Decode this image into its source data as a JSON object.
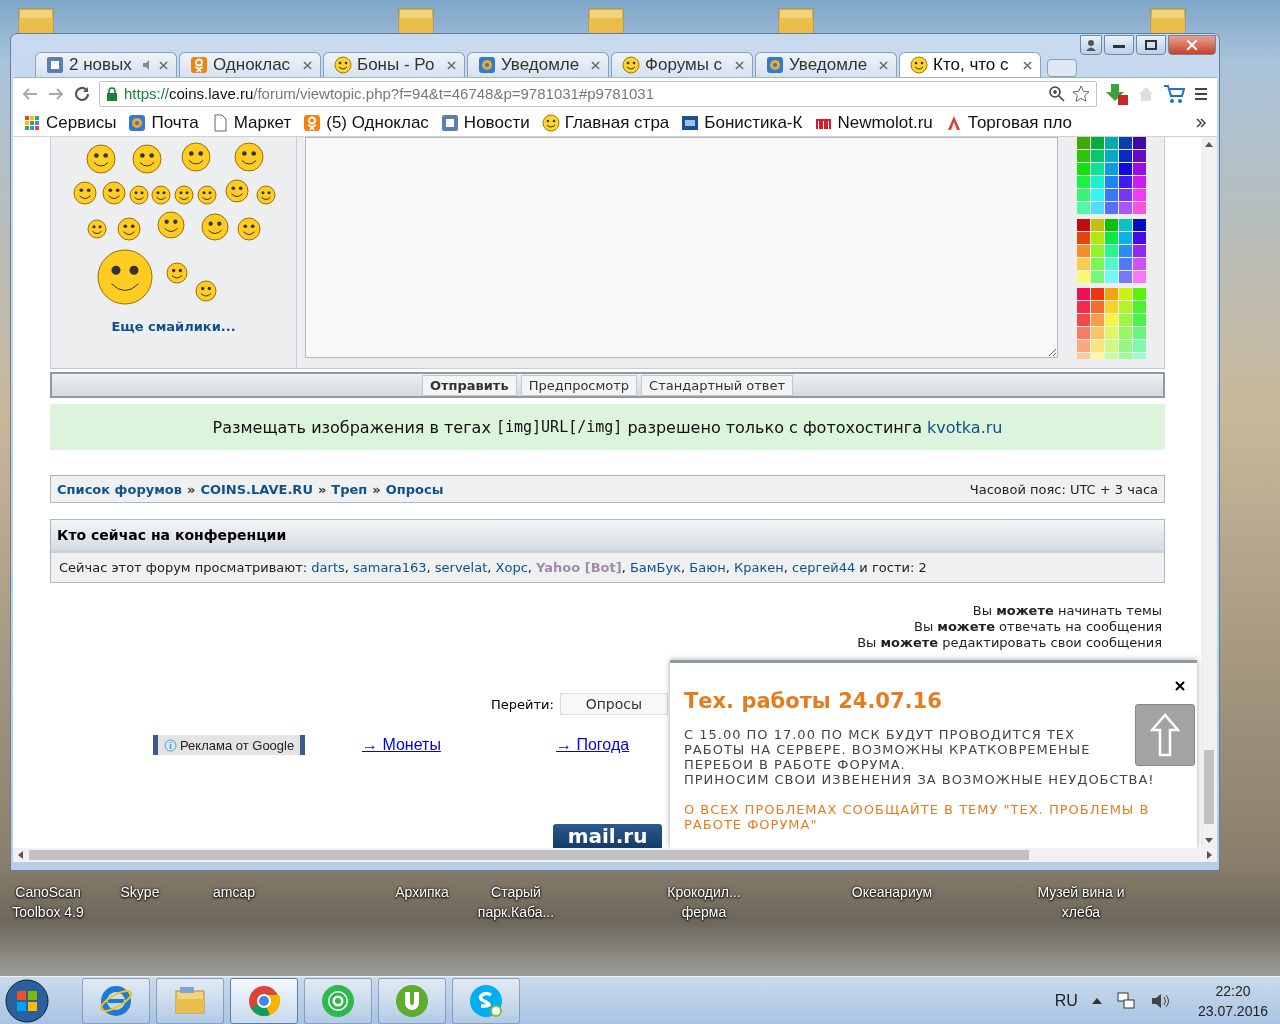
{
  "browser": {
    "tabs": [
      {
        "title": "2 новых",
        "kind": "news",
        "muted": true,
        "selected": false
      },
      {
        "title": "Одноклас",
        "kind": "ok",
        "muted": false,
        "selected": false
      },
      {
        "title": "Боны - Ро",
        "kind": "smiley",
        "muted": false,
        "selected": false
      },
      {
        "title": "Уведомле",
        "kind": "mail",
        "muted": false,
        "selected": false
      },
      {
        "title": "Форумы с",
        "kind": "smiley",
        "muted": false,
        "selected": false
      },
      {
        "title": "Уведомле",
        "kind": "mail",
        "muted": false,
        "selected": false
      },
      {
        "title": "Кто, что с",
        "kind": "smiley",
        "muted": false,
        "selected": true
      }
    ],
    "address": {
      "scheme": "https://",
      "host": "coins.lave.ru",
      "path": "/forum/viewtopic.php?f=94&t=46748&p=9781031#p9781031"
    },
    "bookmarks": [
      {
        "label": "Сервисы",
        "kind": "apps"
      },
      {
        "label": "Почта",
        "kind": "mail"
      },
      {
        "label": "Маркет",
        "kind": "page"
      },
      {
        "label": "(5) Одноклас",
        "kind": "ok"
      },
      {
        "label": "Новости",
        "kind": "news"
      },
      {
        "label": "Главная стра",
        "kind": "smiley"
      },
      {
        "label": "Бонистика-К",
        "kind": "bk"
      },
      {
        "label": "Newmolot.ru",
        "kind": "m"
      },
      {
        "label": "Торговая пло",
        "kind": "a"
      }
    ]
  },
  "posting": {
    "more_smilies": "Еще смайлики...",
    "buttons": [
      {
        "label": "Отправить",
        "primary": true
      },
      {
        "label": "Предпросмотр",
        "primary": false
      },
      {
        "label": "Стандартный ответ",
        "primary": false
      }
    ]
  },
  "notice": {
    "before": "Размещать изображения в тегах ",
    "code": "[img]URL[/img]",
    "after": " разрешено только с фотохостинга ",
    "link": "kvotka.ru"
  },
  "breadcrumbs": {
    "separator": "»",
    "items": [
      "Список форумов",
      "COINS.LAVE.RU",
      "Треп",
      "Опросы"
    ],
    "timezone": "Часовой пояс: UTC + 3 часа"
  },
  "online": {
    "title": "Кто сейчас на конференции",
    "prefix": "Сейчас этот форум просматривают: ",
    "separator": ", ",
    "users": [
      {
        "name": "darts",
        "kind": "user"
      },
      {
        "name": "samara163",
        "kind": "user"
      },
      {
        "name": "servelat",
        "kind": "user"
      },
      {
        "name": "Хорс",
        "kind": "user"
      },
      {
        "name": "Yahoo [Bot]",
        "kind": "bot"
      },
      {
        "name": "БамБук",
        "kind": "user"
      },
      {
        "name": "Баюн",
        "kind": "user"
      },
      {
        "name": "Кракен",
        "kind": "user"
      },
      {
        "name": "сергей44",
        "kind": "user"
      }
    ],
    "suffix": " и гости: 2"
  },
  "permissions": [
    "Вы **можете** начинать темы",
    "Вы **можете** отвечать на сообщения",
    "Вы **можете** редактировать свои сообщения"
  ],
  "jump": {
    "label": "Перейти:",
    "value": "Опросы"
  },
  "ad": {
    "label": "Реклама от Google"
  },
  "links": [
    "→ Монеты",
    "→ Погода"
  ],
  "counter_logo": "mail.ru",
  "popup": {
    "title": "Тех. работы 24.07.16",
    "message": "С 15.00 ПО 17.00 ПО МСК БУДУТ ПРОВОДИТСЯ ТЕХ РАБОТЫ НА СЕРВЕРЕ. ВОЗМОЖНЫ КРАТКОВРЕМЕНЫЕ ПЕРЕБОИ В РАБОТЕ ФОРУМА.",
    "apology": "ПРИНОСИМ СВОИ ИЗВЕНЕНИЯ ЗА ВОЗМОЖНЫЕ НЕУДОБСТВА!",
    "note": "О ВСЕХ ПРОБЛЕМАХ СООБЩАЙТЕ В ТЕМУ \"ТЕХ. ПРОБЛЕМЫ В РАБОТЕ ФОРУМА\""
  },
  "desktop_icons": [
    "CanoScan Toolbox 4.9",
    "Skype",
    "amcap",
    "Архипка",
    "Старый парк.Каба...",
    "Крокодил... ферма",
    "Океанариум",
    "Музей вина и хлеба"
  ],
  "taskbar": {
    "apps": [
      {
        "kind": "ie",
        "selected": false
      },
      {
        "kind": "explorer",
        "selected": false
      },
      {
        "kind": "chrome",
        "selected": true
      },
      {
        "kind": "agent",
        "selected": false
      },
      {
        "kind": "torrent",
        "selected": false
      },
      {
        "kind": "skype",
        "selected": false
      }
    ],
    "language": "RU",
    "time": "22:20",
    "date": "23.07.2016"
  }
}
